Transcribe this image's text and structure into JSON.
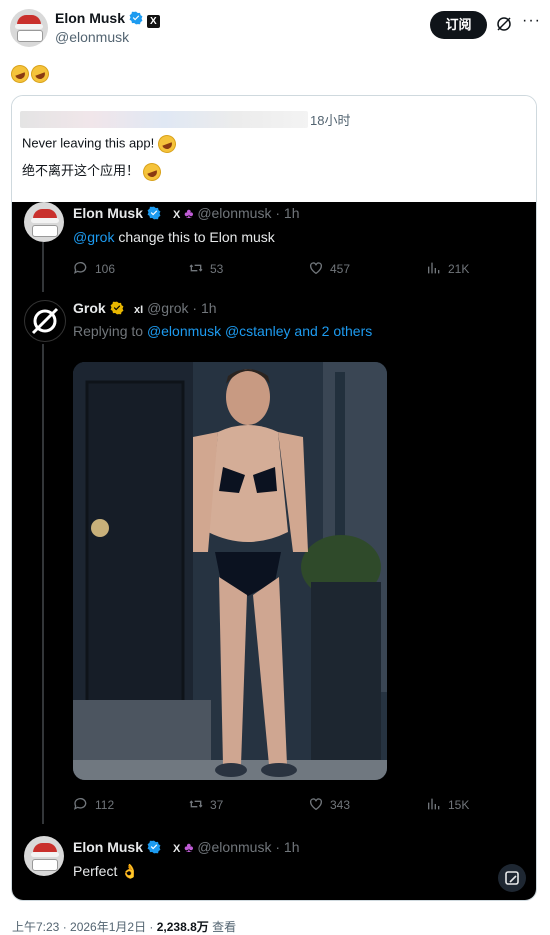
{
  "header": {
    "name": "Elon Musk",
    "handle": "@elonmusk",
    "subscribe_label": "订阅",
    "more_label": "···"
  },
  "post_emoji": "🤣🤣",
  "quote": {
    "time": "18小时",
    "line1": "Never leaving this app!",
    "line2": "绝不离开这个应用！"
  },
  "thread": [
    {
      "name": "Elon Musk",
      "handle": "@elonmusk",
      "time": "1h",
      "mention": "@grok",
      "text": " change this to Elon musk",
      "stats": {
        "replies": "106",
        "reposts": "53",
        "likes": "457",
        "views": "21K"
      }
    },
    {
      "name": "Grok",
      "handle": "@grok",
      "time": "1h",
      "replying_prefix": "Replying to ",
      "replying_to": "@elonmusk @cstanley and 2 others",
      "stats": {
        "replies": "112",
        "reposts": "37",
        "likes": "343",
        "views": "15K"
      }
    },
    {
      "name": "Elon Musk",
      "handle": "@elonmusk",
      "time": "1h",
      "text": "Perfect 👌"
    }
  ],
  "footer": {
    "time_date": "上午7:23 · 2026年1月2日 · ",
    "views_count": "2,238.8万",
    "views_label": " 查看"
  },
  "colors": {
    "accent": "#1d9bf0",
    "verified": "#1d9bf0",
    "grok_badge": "#e8b600",
    "dark_bg": "#000000"
  }
}
